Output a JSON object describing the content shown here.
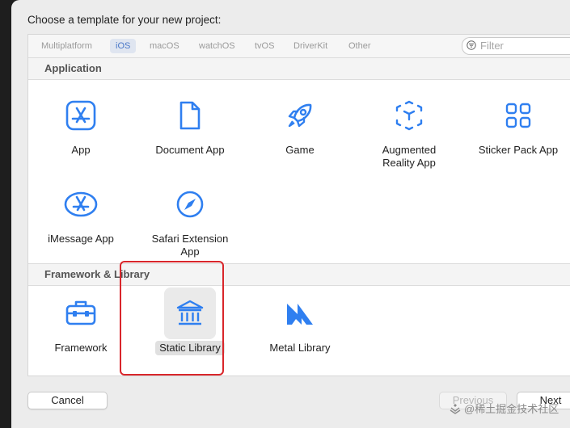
{
  "dialog": {
    "title": "Choose a template for your new project:"
  },
  "tabs": [
    {
      "label": "Multiplatform",
      "active": false
    },
    {
      "label": "iOS",
      "active": true
    },
    {
      "label": "macOS",
      "active": false
    },
    {
      "label": "watchOS",
      "active": false
    },
    {
      "label": "tvOS",
      "active": false
    },
    {
      "label": "DriverKit",
      "active": false
    },
    {
      "label": "Other",
      "active": false
    }
  ],
  "filter": {
    "placeholder": "Filter",
    "value": ""
  },
  "sections": [
    {
      "title": "Application",
      "templates": [
        {
          "label": "App",
          "icon": "app-store-icon"
        },
        {
          "label": "Document App",
          "icon": "document-icon"
        },
        {
          "label": "Game",
          "icon": "rocket-icon"
        },
        {
          "label": "Augmented\nReality App",
          "icon": "ar-cube-icon"
        },
        {
          "label": "Sticker Pack App",
          "icon": "grid-icon"
        },
        {
          "label": "iMessage App",
          "icon": "imessage-app-icon"
        },
        {
          "label": "Safari Extension\nApp",
          "icon": "compass-icon"
        }
      ]
    },
    {
      "title": "Framework & Library",
      "templates": [
        {
          "label": "Framework",
          "icon": "toolbox-icon"
        },
        {
          "label": "Static Library",
          "icon": "library-building-icon",
          "selected": true
        },
        {
          "label": "Metal Library",
          "icon": "metal-icon"
        }
      ]
    }
  ],
  "buttons": {
    "cancel": "Cancel",
    "previous": "Previous",
    "next": "Next"
  },
  "watermark": {
    "text": "@稀土掘金技术社区"
  },
  "colors": {
    "accent": "#2f7ff0",
    "selection_outline": "#d9262b"
  }
}
